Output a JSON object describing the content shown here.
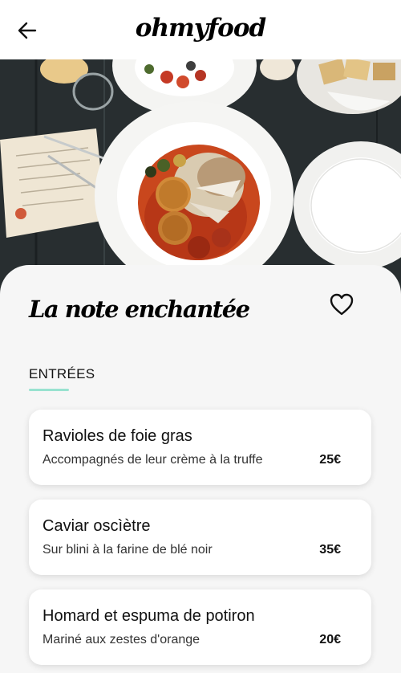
{
  "header": {
    "brand": "ohmyfood",
    "back_icon": "arrow-left-icon"
  },
  "restaurant": {
    "name": "La note enchantée",
    "favorite_icon": "heart-outline-icon"
  },
  "section": {
    "title": "ENTRÉES",
    "accent_color": "#99e2d0"
  },
  "items": [
    {
      "name": "Ravioles de foie gras",
      "description": "Accompagnés de leur crème à la truffe",
      "price": "25€"
    },
    {
      "name": "Caviar oscìètre",
      "description": "Sur blini à la farine de blé noir",
      "price": "35€"
    },
    {
      "name": "Homard et espuma de potiron",
      "description": "Mariné aux zestes d'orange",
      "price": "20€"
    }
  ]
}
